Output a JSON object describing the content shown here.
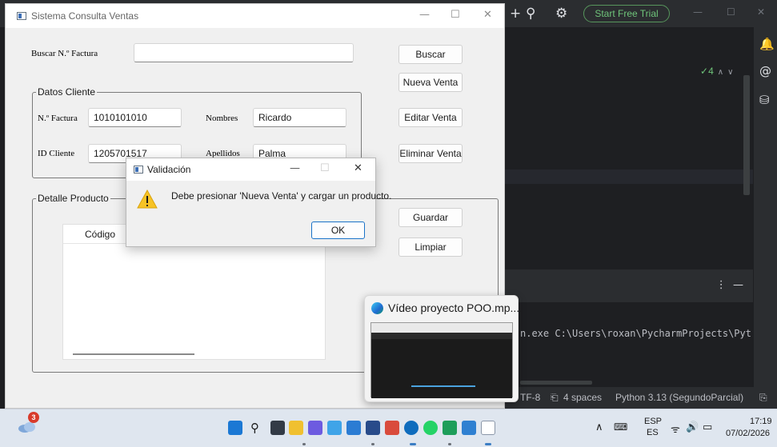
{
  "ide": {
    "trial_button": "Start Free Trial",
    "inspections_count": "4",
    "console_text": "n.exe C:\\Users\\roxan\\PycharmProjects\\Pyt",
    "status_encoding": "TF-8",
    "status_indent": "4 spaces",
    "status_interpreter": "Python 3.13 (SegundoParcial)",
    "colors": {
      "bg": "#1e1f22",
      "panel": "#2b2d30",
      "accent_green": "#6fc47a"
    }
  },
  "app": {
    "title": "Sistema Consulta Ventas",
    "search_label": "Buscar N.º Factura",
    "search_value": "",
    "buttons": {
      "buscar": "Buscar",
      "nueva_venta": "Nueva Venta",
      "editar_venta": "Editar Venta",
      "eliminar_venta": "Eliminar Venta",
      "guardar": "Guardar",
      "limpiar": "Limpiar"
    },
    "datos_cliente": {
      "legend": "Datos Cliente",
      "factura_label": "N.º Factura",
      "factura_value": "1010101010",
      "nombres_label": "Nombres",
      "nombres_value": "Ricardo",
      "id_label": "ID Cliente",
      "id_value": "1205701517",
      "apellidos_label": "Apellidos",
      "apellidos_value": "Palma"
    },
    "detalle_producto": {
      "legend": "Detalle Producto",
      "columns": [
        "Código"
      ]
    }
  },
  "dialog": {
    "title": "Validación",
    "message": "Debe presionar 'Nueva Venta' y cargar un producto.",
    "ok": "OK"
  },
  "thumbnail": {
    "title": "Vídeo proyecto POO.mp..."
  },
  "taskbar": {
    "weather_badge": "3",
    "lang_top": "ESP",
    "lang_bottom": "ES",
    "time": "17:19",
    "date": "07/02/2026"
  }
}
